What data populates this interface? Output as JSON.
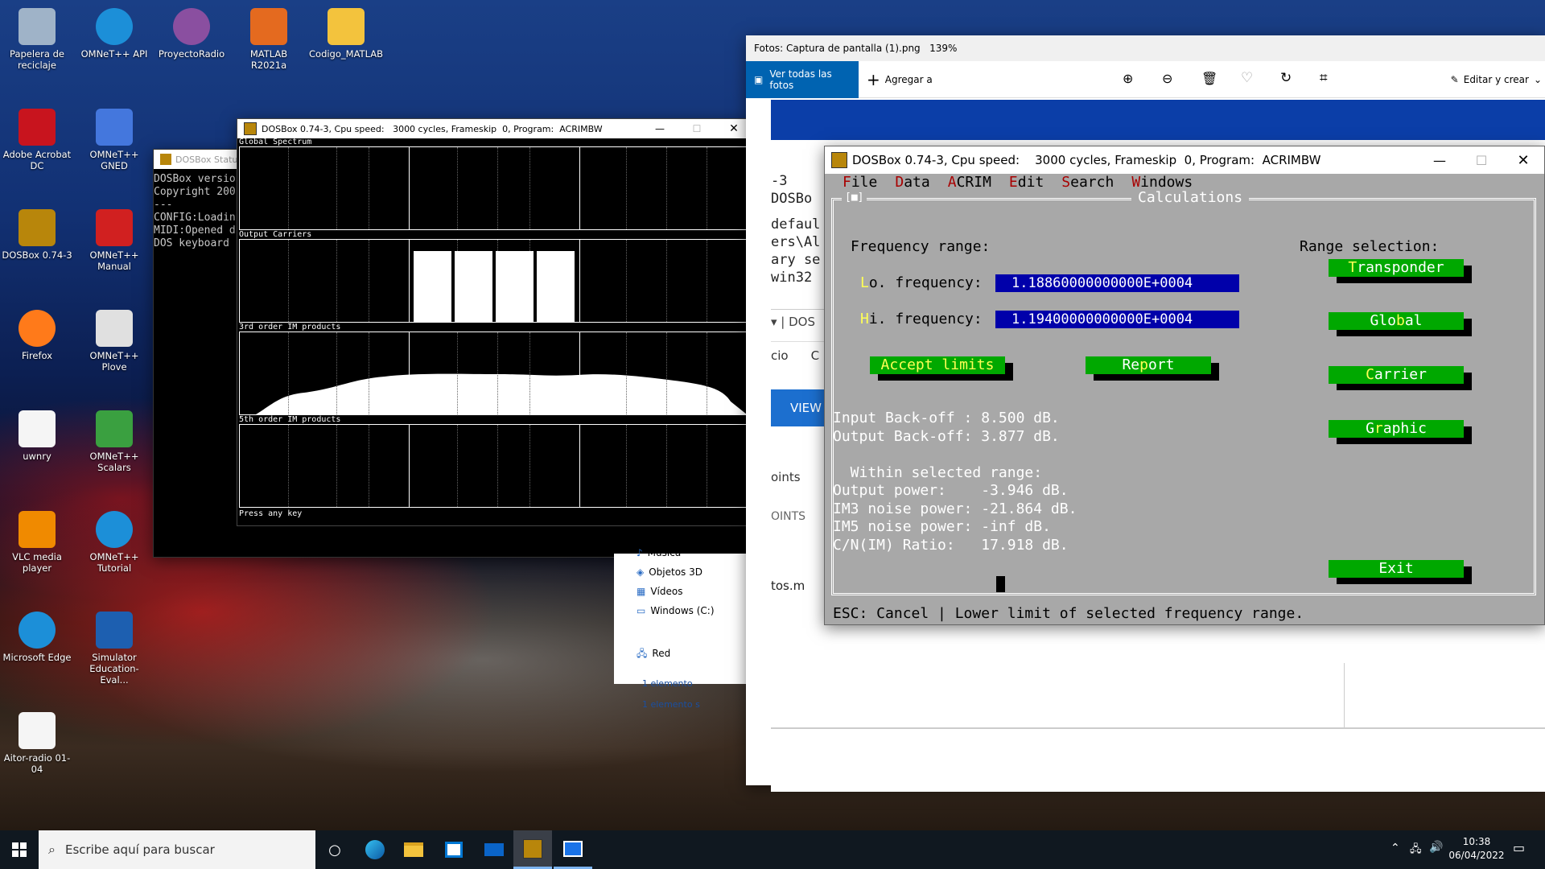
{
  "desktop": {
    "icons": [
      {
        "label": "Papelera de reciclaje",
        "icon": "recycle-bin-icon"
      },
      {
        "label": "OMNeT++ API",
        "icon": "edge-icon"
      },
      {
        "label": "ProyectoRadio",
        "icon": "pr-icon"
      },
      {
        "label": "MATLAB R2021a",
        "icon": "matlab-icon"
      },
      {
        "label": "Codigo_MATLAB",
        "icon": "folder-icon"
      },
      {
        "label": "Adobe Acrobat DC",
        "icon": "acrobat-icon"
      },
      {
        "label": "OMNeT++ GNED",
        "icon": "gned-icon"
      },
      {
        "label": "DOSBox 0.74-3",
        "icon": "dosbox-icon"
      },
      {
        "label": "OMNeT++ Manual",
        "icon": "pdf-icon"
      },
      {
        "label": "Firefox",
        "icon": "firefox-icon"
      },
      {
        "label": "OMNeT++ Plove",
        "icon": "plove-icon"
      },
      {
        "label": "uwnry",
        "icon": "file-icon"
      },
      {
        "label": "OMNeT++ Scalars",
        "icon": "scalars-icon"
      },
      {
        "label": "VLC media player",
        "icon": "vlc-icon"
      },
      {
        "label": "OMNeT++ Tutorial",
        "icon": "edge-icon"
      },
      {
        "label": "Microsoft Edge",
        "icon": "edge-icon"
      },
      {
        "label": "Simulator Education-Eval...",
        "icon": "simulator-icon"
      },
      {
        "label": "Aitor-radio 01-04",
        "icon": "file-icon"
      }
    ]
  },
  "status_window": {
    "title": "DOSBox Status",
    "lines": [
      "DOSBox versio",
      "Copyright 200",
      "---",
      "CONFIG:Loadin",
      "MIDI:Opened d",
      "DOS keyboard"
    ]
  },
  "dos_graph_window": {
    "title": "DOSBox 0.74-3, Cpu speed:   3000 cycles, Frameskip  0, Program:  ACRIMBW",
    "panels": [
      "Global Spectrum",
      "Output Carriers",
      "3rd order IM products",
      "5th order IM products"
    ],
    "footer": "Press any key",
    "carriers": 4
  },
  "explorer": {
    "items": [
      "Música",
      "Objetos 3D",
      "Vídeos",
      "Windows (C:)",
      "Red"
    ],
    "status_left": "1 elemento",
    "status_right": "1 elemento s"
  },
  "photos": {
    "title": "Fotos: Captura de pantalla (1).png   139%",
    "see_all": "Ver todas las fotos",
    "add_to": "Agregar a",
    "edit_create": "Editar y crear",
    "bg_lines": [
      "-3",
      "DOSBo",
      "defaul",
      "ers\\Al",
      "ary se",
      "win32"
    ],
    "bg_dos": "DOS",
    "bg_cio": "cio",
    "bg_c": "C",
    "bg_view": "VIEW",
    "bg_oints": "oints",
    "bg_points": "OINTS",
    "bg_tosm": "tos.m"
  },
  "acrim": {
    "title": "DOSBox 0.74-3, Cpu speed:    3000 cycles, Frameskip  0, Program:  ACRIMBW",
    "menu": [
      {
        "hk": "F",
        "rest": "ile"
      },
      {
        "hk": "D",
        "rest": "ata"
      },
      {
        "hk": "A",
        "rest": "CRIM"
      },
      {
        "hk": "E",
        "rest": "dit"
      },
      {
        "hk": "S",
        "rest": "earch"
      },
      {
        "hk": "W",
        "rest": "indows"
      }
    ],
    "dialog_title": "Calculations",
    "dialog_marker": "[■]",
    "freq_range": "Frequency range:",
    "range_sel": "Range selection:",
    "lo_hk": "L",
    "lo_rest": "o. frequency:",
    "lo_val": "1.18860000000000E+0004",
    "hi_hk": "H",
    "hi_rest": "i. frequency:",
    "hi_val": "1.19400000000000E+0004",
    "accept": {
      "hk": "A",
      "rest": "ccept limits"
    },
    "report": {
      "pre": "Re",
      "hk": "p",
      "rest": "ort"
    },
    "buttons": [
      {
        "pre": "",
        "hk": "T",
        "rest": "ransponder"
      },
      {
        "pre": "Glo",
        "hk": "b",
        "rest": "al"
      },
      {
        "pre": "",
        "hk": "C",
        "rest": "arrier"
      },
      {
        "pre": "G",
        "hk": "r",
        "rest": "aphic"
      }
    ],
    "exit": "Exit",
    "results": [
      "Input Back-off : 8.500 dB.",
      "Output Back-off: 3.877 dB.",
      "",
      "  Within selected range:",
      "Output power:    -3.946 dB.",
      "IM3 noise power: -21.864 dB.",
      "IM5 noise power: -inf dB.",
      "C/N(IM) Ratio:   17.918 dB."
    ],
    "status": "ESC: Cancel | Lower limit of selected frequency range."
  },
  "taskbar": {
    "search": "Escribe aquí para buscar",
    "time": "10:38",
    "date": "06/04/2022"
  }
}
